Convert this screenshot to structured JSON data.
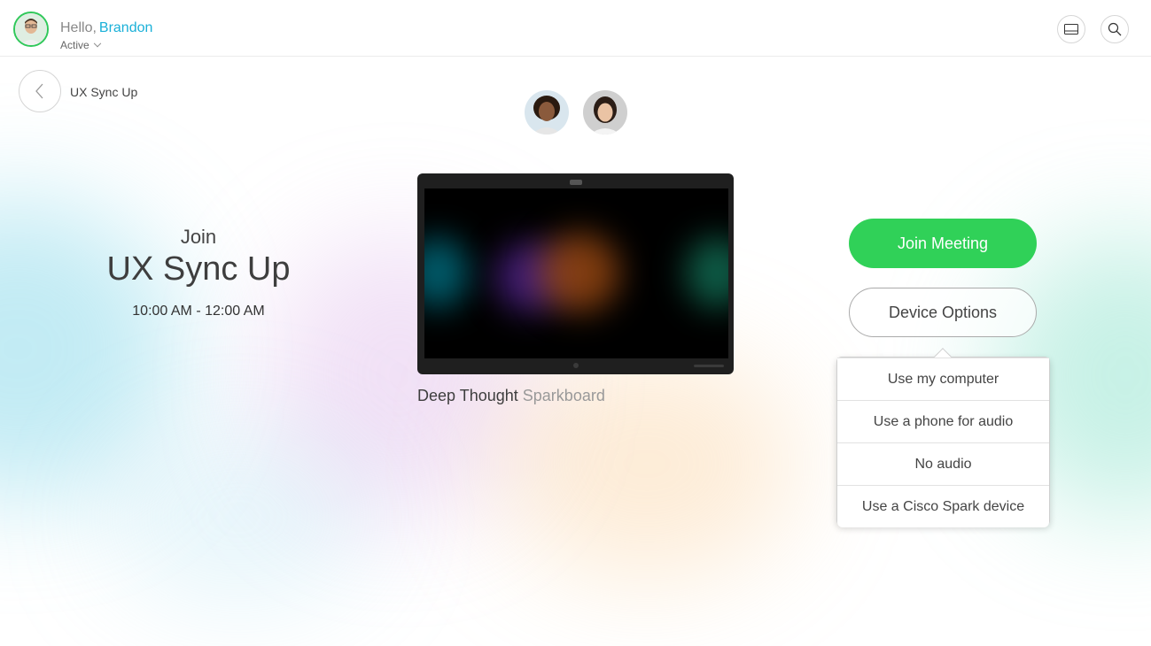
{
  "header": {
    "greeting": "Hello,",
    "user_name": "Brandon",
    "status": "Active"
  },
  "meeting": {
    "breadcrumb": "UX Sync Up",
    "join_label": "Join",
    "title": "UX Sync Up",
    "time": "10:00 AM - 12:00 AM"
  },
  "device": {
    "name": "Deep Thought",
    "type": "Sparkboard"
  },
  "actions": {
    "join_button": "Join Meeting",
    "device_options_button": "Device Options"
  },
  "device_menu": {
    "items": [
      "Use my computer",
      "Use a phone for audio",
      "No audio",
      "Use a Cisco Spark device"
    ]
  },
  "colors": {
    "accent_green": "#30d158",
    "name_blue": "#1ab0d8"
  }
}
